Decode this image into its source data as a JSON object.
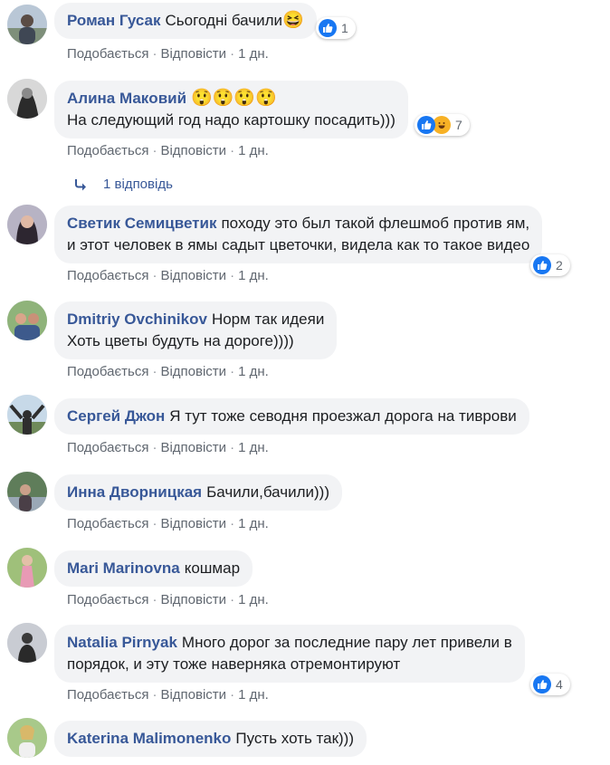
{
  "actions": {
    "like": "Подобається",
    "reply": "Відповісти",
    "sep": "·"
  },
  "reply_link": {
    "label": "1 відповідь"
  },
  "comments": [
    {
      "author": "Роман Гусак",
      "lines": [
        "Сьогодні бачили"
      ],
      "emoji": "😆",
      "reactions": [
        "like"
      ],
      "reaction_count": "1",
      "time": "1 дн."
    },
    {
      "author": "Алина Макoвий",
      "author_emoji": "😲😲😲😲",
      "lines": [
        "На следующий год надо картошку посадить)))"
      ],
      "reactions": [
        "like",
        "haha"
      ],
      "reaction_count": "7",
      "time": "1 дн."
    },
    {
      "author": "Светик Семицветик",
      "lines": [
        "походу это был такой флешмоб против ям,",
        "и этот человек в ямы садыт цветочки, видела как то такое видео"
      ],
      "reactions": [
        "like"
      ],
      "reaction_count": "2",
      "time": "1 дн."
    },
    {
      "author": "Dmitriy Ovchinikov",
      "lines": [
        "Норм так идеяи",
        "Хоть цветы будуть на дороге))))"
      ],
      "time": "1 дн."
    },
    {
      "author": "Сергей Джон",
      "lines": [
        "Я тут тоже севодня проезжал дорога на тиврови"
      ],
      "time": "1 дн."
    },
    {
      "author": "Инна Дворницкая",
      "lines": [
        "Бачили,бачили)))"
      ],
      "time": "1 дн."
    },
    {
      "author": "Mari Marinovna",
      "lines": [
        "кошмар"
      ],
      "time": "1 дн."
    },
    {
      "author": "Natalia Pirnyak",
      "lines": [
        "Много дорог за последние пару лет привели в",
        "порядок, и эту тоже наверняка отремонтируют"
      ],
      "reactions": [
        "like"
      ],
      "reaction_count": "4",
      "time": "1 дн."
    },
    {
      "author": "Katerina Malimonenko",
      "lines": [
        "Пусть хоть так)))"
      ]
    }
  ]
}
